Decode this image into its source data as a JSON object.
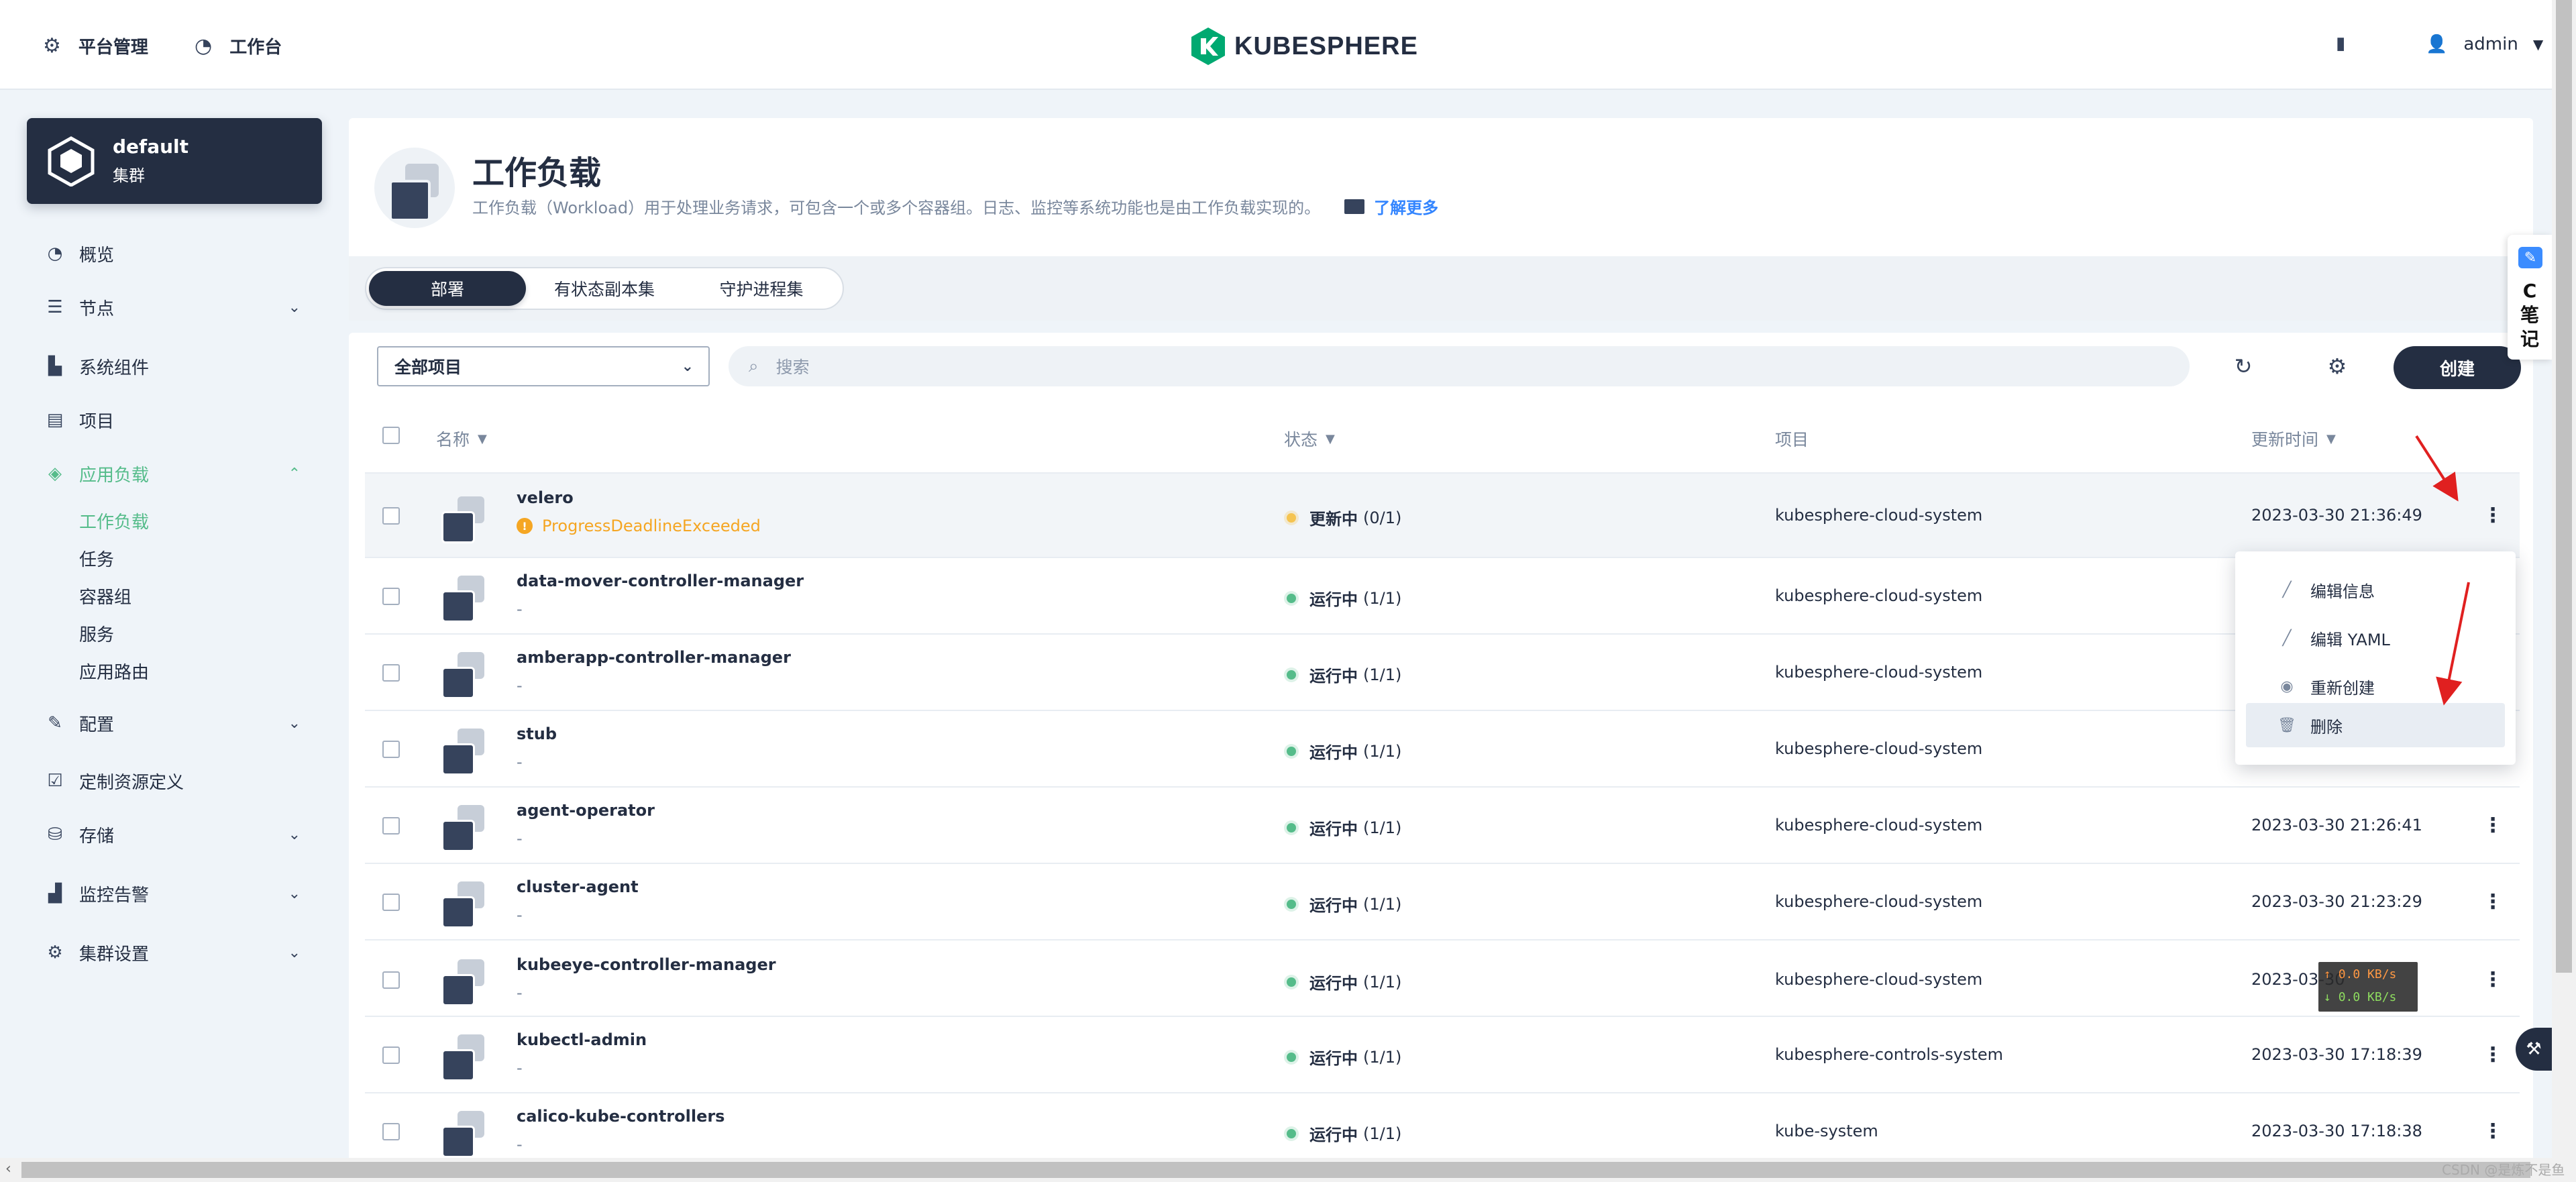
{
  "header": {
    "nav": [
      {
        "label": "平台管理",
        "icon": "gear-icon"
      },
      {
        "label": "工作台",
        "icon": "workbench-icon"
      }
    ],
    "logo_text": "KUBESPHERE",
    "user": "admin"
  },
  "sidebar": {
    "cluster_name": "default",
    "cluster_type": "集群",
    "items": [
      {
        "label": "概览",
        "icon": "overview-icon"
      },
      {
        "label": "节点",
        "icon": "nodes-icon"
      },
      {
        "label": "系统组件",
        "icon": "components-icon"
      },
      {
        "label": "项目",
        "icon": "project-icon"
      },
      {
        "label": "应用负载",
        "icon": "layers-icon"
      },
      {
        "label": "配置",
        "icon": "wrench-icon"
      },
      {
        "label": "定制资源定义",
        "icon": "crd-icon"
      },
      {
        "label": "存储",
        "icon": "storage-icon"
      },
      {
        "label": "监控告警",
        "icon": "monitor-icon"
      },
      {
        "label": "集群设置",
        "icon": "gear-icon"
      }
    ],
    "subitems": [
      "工作负载",
      "任务",
      "容器组",
      "服务",
      "应用路由"
    ]
  },
  "banner": {
    "title": "工作负载",
    "description": "工作负载（Workload）用于处理业务请求，可包含一个或多个容器组。日志、监控等系统功能也是由工作负载实现的。",
    "learn_more": "了解更多"
  },
  "tabs": [
    "部署",
    "有状态副本集",
    "守护进程集"
  ],
  "toolbar": {
    "project_select": "全部项目",
    "search_placeholder": "搜索",
    "create_label": "创建"
  },
  "table": {
    "columns": {
      "name": "名称",
      "status": "状态",
      "project": "项目",
      "updated": "更新时间"
    },
    "rows": [
      {
        "name": "velero",
        "sub": "ProgressDeadlineExceeded",
        "status": "更新中",
        "count": "(0/1)",
        "project": "kubesphere-cloud-system",
        "time": "2023-03-30 21:36:49"
      },
      {
        "name": "data-mover-controller-manager",
        "sub": "-",
        "status": "运行中",
        "count": "(1/1)",
        "project": "kubesphere-cloud-system",
        "time": ""
      },
      {
        "name": "amberapp-controller-manager",
        "sub": "-",
        "status": "运行中",
        "count": "(1/1)",
        "project": "kubesphere-cloud-system",
        "time": ""
      },
      {
        "name": "stub",
        "sub": "-",
        "status": "运行中",
        "count": "(1/1)",
        "project": "kubesphere-cloud-system",
        "time": ""
      },
      {
        "name": "agent-operator",
        "sub": "-",
        "status": "运行中",
        "count": "(1/1)",
        "project": "kubesphere-cloud-system",
        "time": "2023-03-30 21:26:41"
      },
      {
        "name": "cluster-agent",
        "sub": "-",
        "status": "运行中",
        "count": "(1/1)",
        "project": "kubesphere-cloud-system",
        "time": "2023-03-30 21:23:29"
      },
      {
        "name": "kubeeye-controller-manager",
        "sub": "-",
        "status": "运行中",
        "count": "(1/1)",
        "project": "kubesphere-cloud-system",
        "time": "2023-03-30"
      },
      {
        "name": "kubectl-admin",
        "sub": "-",
        "status": "运行中",
        "count": "(1/1)",
        "project": "kubesphere-controls-system",
        "time": "2023-03-30 17:18:39"
      },
      {
        "name": "calico-kube-controllers",
        "sub": "-",
        "status": "运行中",
        "count": "(1/1)",
        "project": "kube-system",
        "time": "2023-03-30 17:18:38"
      }
    ]
  },
  "menu": {
    "items": [
      {
        "label": "编辑信息",
        "icon": "pencil-icon"
      },
      {
        "label": "编辑 YAML",
        "icon": "pencil-icon"
      },
      {
        "label": "重新创建",
        "icon": "refresh-icon"
      },
      {
        "label": "删除",
        "icon": "trash-icon"
      }
    ]
  },
  "netspeed": {
    "up": "0.0 KB/s",
    "down": "0.0 KB/s"
  },
  "note_widget": {
    "label": "C笔记"
  },
  "watermark": "CSDN @是炼不是鱼",
  "colors": {
    "primary": "#242e42",
    "accent_green": "#55bc8a",
    "warning": "#f5a623",
    "link": "#3385ff",
    "annotation_red": "#e02020"
  }
}
